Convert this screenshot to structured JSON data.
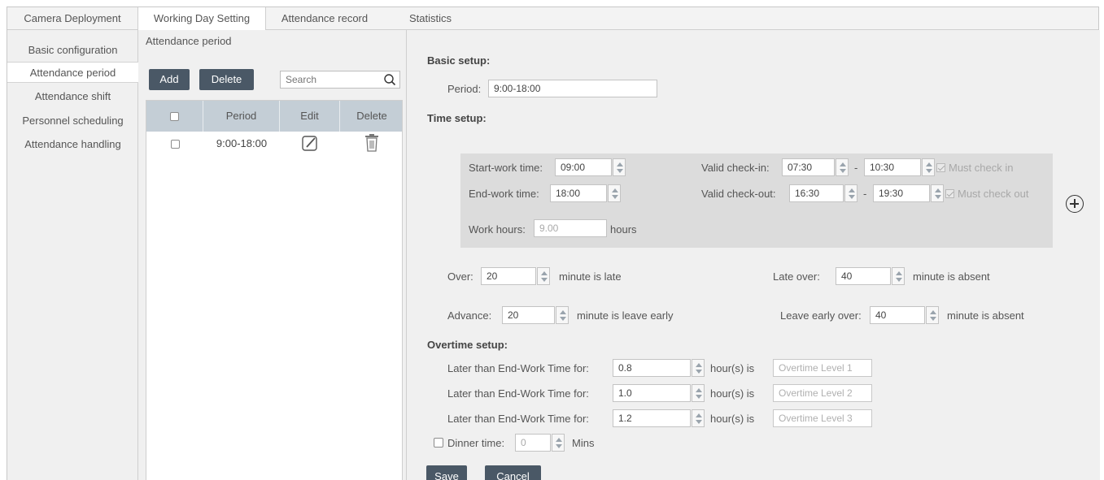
{
  "tabs": [
    {
      "label": "Camera Deployment",
      "active": false
    },
    {
      "label": "Working Day Setting",
      "active": true
    },
    {
      "label": "Attendance record",
      "active": false
    },
    {
      "label": "Statistics",
      "active": false
    }
  ],
  "left_menu": [
    {
      "label": "Basic configuration",
      "active": false
    },
    {
      "label": "Attendance period",
      "active": true
    },
    {
      "label": "Attendance shift",
      "active": false
    },
    {
      "label": "Personnel scheduling",
      "active": false
    },
    {
      "label": "Attendance handling",
      "active": false
    }
  ],
  "middle": {
    "title": "Attendance period",
    "add_label": "Add",
    "delete_label": "Delete",
    "search_placeholder": "Search",
    "columns": [
      "",
      "Period",
      "Edit",
      "Delete"
    ],
    "rows": [
      {
        "period": "9:00-18:00"
      }
    ]
  },
  "basic_setup": {
    "title": "Basic setup:",
    "period_label": "Period:",
    "period_value": "9:00-18:00"
  },
  "time_setup": {
    "title": "Time setup:",
    "start_label": "Start-work time:",
    "start_value": "09:00",
    "end_label": "End-work time:",
    "end_value": "18:00",
    "checkin_label": "Valid check-in:",
    "checkin_from": "07:30",
    "checkin_to": "10:30",
    "checkout_label": "Valid check-out:",
    "checkout_from": "16:30",
    "checkout_to": "19:30",
    "dash": "-",
    "must_in": "Must check in",
    "must_out": "Must check out",
    "work_hours_label": "Work hours:",
    "work_hours_value": "9.00",
    "hours_unit": "hours"
  },
  "rules": {
    "over_label": "Over:",
    "over_value": "20",
    "over_suffix": "minute is late",
    "late_over_label": "Late over:",
    "late_over_value": "40",
    "late_over_suffix": "minute is absent",
    "advance_label": "Advance:",
    "advance_value": "20",
    "advance_suffix": "minute is leave early",
    "leave_early_label": "Leave early over:",
    "leave_early_value": "40",
    "leave_early_suffix": "minute is absent"
  },
  "overtime": {
    "title": "Overtime setup:",
    "rows": [
      {
        "label": "Later than End-Work Time for:",
        "value": "0.8",
        "suffix": "hour(s) is",
        "level": "Overtime Level 1"
      },
      {
        "label": "Later than End-Work Time for:",
        "value": "1.0",
        "suffix": "hour(s) is",
        "level": "Overtime Level 2"
      },
      {
        "label": "Later than End-Work Time for:",
        "value": "1.2",
        "suffix": "hour(s) is",
        "level": "Overtime Level 3"
      }
    ],
    "dinner_label": "Dinner time:",
    "dinner_value": "0",
    "dinner_unit": "Mins"
  },
  "actions": {
    "save_label": "Save",
    "cancel_label": "Cancel"
  },
  "colors": {
    "button_dark": "#4a5866",
    "grid_header": "#c4ced6",
    "panel_bg": "#f0f0f0",
    "timebox_bg": "#dcdcdc"
  }
}
